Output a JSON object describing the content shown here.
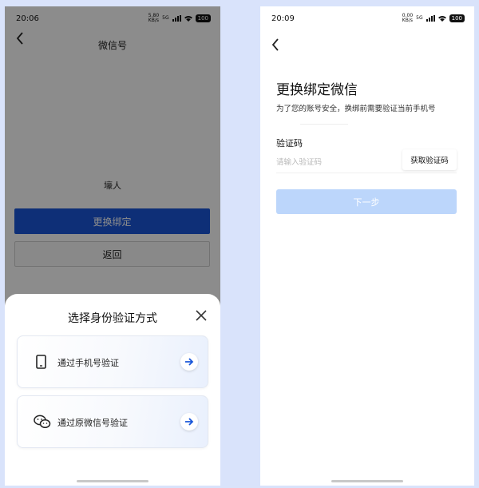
{
  "left": {
    "status": {
      "time": "20:06",
      "net_speed": "5.80\nKB/s",
      "network": "5G",
      "battery": "100"
    },
    "title": "微信号",
    "wechat_name": "壕人",
    "change_bind_button": "更换绑定",
    "return_button": "返回",
    "sheet": {
      "title": "选择身份验证方式",
      "options": [
        {
          "label": "通过手机号验证",
          "icon": "phone-icon"
        },
        {
          "label": "通过原微信号验证",
          "icon": "wechat-icon"
        }
      ]
    }
  },
  "right": {
    "status": {
      "time": "20:09",
      "net_speed": "0.00\nKB/s",
      "network": "5G",
      "battery": "100"
    },
    "title": "更换绑定微信",
    "subtitle": "为了您的账号安全，换绑前需要验证当前手机号",
    "code_label": "验证码",
    "code_placeholder": "请输入验证码",
    "get_code_button": "获取验证码",
    "next_button": "下一步"
  },
  "colors": {
    "page_bg": "#d9e3fb",
    "primary": "#1a57d9",
    "disabled_primary": "#bcd6fb",
    "arrow_accent": "#1a57d9"
  }
}
